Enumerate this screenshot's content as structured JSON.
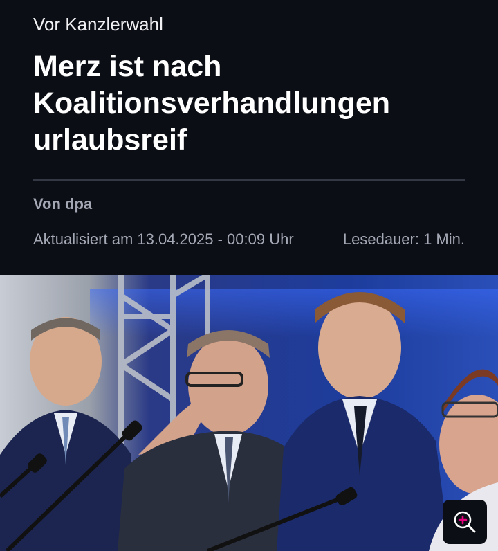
{
  "article": {
    "kicker": "Vor Kanzlerwahl",
    "title": "Merz ist nach Koalitionsverhandlungen urlaubsreif",
    "author": "Von dpa",
    "updated": "Aktualisiert am 13.04.2025 - 00:09 Uhr",
    "read_time": "Lesedauer: 1 Min."
  },
  "photo": {
    "zoom_icon": "zoom-in-icon",
    "colors": {
      "backdrop_blue": "#1f3a8a",
      "zoom_accent": "#e6007e"
    }
  }
}
